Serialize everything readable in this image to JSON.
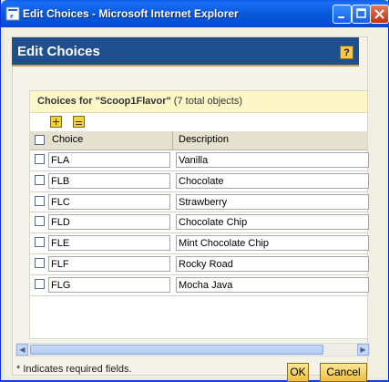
{
  "window": {
    "title": "Edit Choices - Microsoft Internet Explorer"
  },
  "header": {
    "title": "Edit Choices",
    "help": "?"
  },
  "panel": {
    "title_prefix": "Choices for ",
    "title_name": "\"Scoop1Flavor\"",
    "title_suffix": " (7 total objects)"
  },
  "table": {
    "columns": [
      "Choice",
      "Description"
    ],
    "rows": [
      {
        "choice": "FLA",
        "description": "Vanilla"
      },
      {
        "choice": "FLB",
        "description": "Chocolate"
      },
      {
        "choice": "FLC",
        "description": "Strawberry"
      },
      {
        "choice": "FLD",
        "description": "Chocolate Chip"
      },
      {
        "choice": "FLE",
        "description": "Mint Chocolate Chip"
      },
      {
        "choice": "FLF",
        "description": "Rocky Road"
      },
      {
        "choice": "FLG",
        "description": "Mocha Java"
      }
    ]
  },
  "footer": {
    "note": "* Indicates required fields.",
    "ok": "OK",
    "cancel": "Cancel"
  },
  "icons": [
    "ie-icon",
    "minimize-icon",
    "maximize-icon",
    "close-icon",
    "help-icon",
    "expand-all-icon",
    "collapse-all-icon"
  ],
  "colors": {
    "title_bar": "#0758d9",
    "header": "#1f4f8e",
    "panel_title": "#fdf7c7",
    "button": "#eebf3b"
  }
}
